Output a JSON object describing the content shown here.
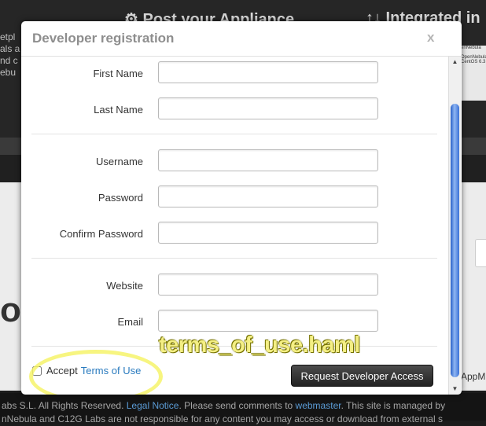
{
  "background": {
    "heading_left": "⚙ Post your Appliance",
    "heading_right": "↑↓ Integrated in",
    "left_snippet": "etpl\nals a\nnd c\nebu",
    "big_letters": "ou",
    "thumb_text": "enNebula\n\nOpenNebula\nCentOS 6.3",
    "appm": "AppM",
    "footer": {
      "line1_prefix": "abs S.L. All Rights Reserved. ",
      "legal_notice": "Legal Notice",
      "line1_mid": ". Please send comments to ",
      "webmaster": "webmaster",
      "line1_suffix": ". This site is managed by",
      "line2": "nNebula and C12G Labs are not responsible for any content you may access or download from external s"
    }
  },
  "modal": {
    "title": "Developer registration",
    "close": "x",
    "fields": [
      {
        "label": "First Name",
        "value": ""
      },
      {
        "label": "Last Name",
        "value": ""
      },
      {
        "label": "Username",
        "value": ""
      },
      {
        "label": "Password",
        "value": ""
      },
      {
        "label": "Confirm Password",
        "value": ""
      },
      {
        "label": "Website",
        "value": ""
      },
      {
        "label": "Email",
        "value": ""
      }
    ],
    "accept_label": "Accept",
    "terms_link": "Terms of Use",
    "accept_checked": false,
    "submit_label": "Request Developer Access"
  },
  "annotation": "terms_of_use.haml",
  "scrollbar": {
    "up_arrow": "▲",
    "down_arrow": "▼"
  },
  "colors": {
    "link": "#2a7bbf",
    "highlight": "#f6f36a",
    "scroll_thumb": "#3b71d6"
  }
}
